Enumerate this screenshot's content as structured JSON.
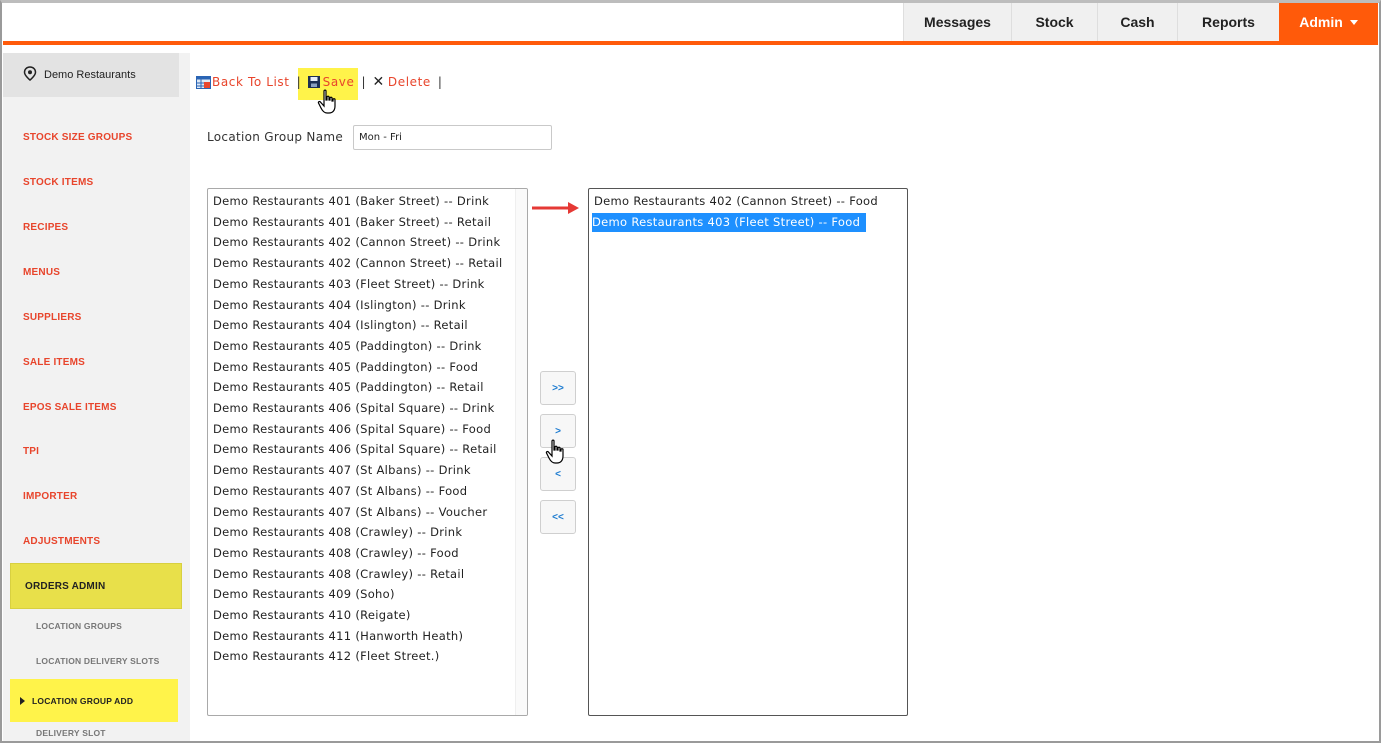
{
  "topnav": {
    "items": [
      "Messages",
      "Stock",
      "Cash",
      "Reports"
    ],
    "admin_label": "Admin"
  },
  "sidebar": {
    "header": "Demo Restaurants",
    "items": [
      "STOCK SIZE GROUPS",
      "STOCK ITEMS",
      "RECIPES",
      "MENUS",
      "SUPPLIERS",
      "SALE ITEMS",
      "EPOS SALE ITEMS",
      "TPI",
      "IMPORTER",
      "ADJUSTMENTS",
      "ORDERS ADMIN"
    ],
    "subitems": [
      "LOCATION GROUPS",
      "LOCATION DELIVERY SLOTS",
      "LOCATION GROUP ADD",
      "DELIVERY SLOT"
    ]
  },
  "toolbar": {
    "back_label": "Back To List",
    "save_label": "Save",
    "delete_label": "Delete",
    "separator": "|"
  },
  "form": {
    "group_name_label": "Location Group Name",
    "group_name_value": "Mon - Fri"
  },
  "available_locations": [
    "Demo Restaurants 401 (Baker Street) -- Drink",
    "Demo Restaurants 401 (Baker Street) -- Retail",
    "Demo Restaurants 402 (Cannon Street) -- Drink",
    "Demo Restaurants 402 (Cannon Street) -- Retail",
    "Demo Restaurants 403 (Fleet Street) -- Drink",
    "Demo Restaurants 404 (Islington) -- Drink",
    "Demo Restaurants 404 (Islington) -- Retail",
    "Demo Restaurants 405 (Paddington) -- Drink",
    "Demo Restaurants 405 (Paddington) -- Food",
    "Demo Restaurants 405 (Paddington) -- Retail",
    "Demo Restaurants 406 (Spital Square) -- Drink",
    "Demo Restaurants 406 (Spital Square) -- Food",
    "Demo Restaurants 406 (Spital Square) -- Retail",
    "Demo Restaurants 407 (St Albans) -- Drink",
    "Demo Restaurants 407 (St Albans) -- Food",
    "Demo Restaurants 407 (St Albans) -- Voucher",
    "Demo Restaurants 408 (Crawley) -- Drink",
    "Demo Restaurants 408 (Crawley) -- Food",
    "Demo Restaurants 408 (Crawley) -- Retail",
    "Demo Restaurants 409 (Soho)",
    "Demo Restaurants 410 (Reigate)",
    "Demo Restaurants 411 (Hanworth Heath)",
    "Demo Restaurants 412 (Fleet Street.)"
  ],
  "selected_locations": [
    "Demo Restaurants 402 (Cannon Street) -- Food",
    "Demo Restaurants 403 (Fleet Street) -- Food"
  ],
  "move_buttons": {
    "move_all_right": ">>",
    "move_right": ">",
    "move_left": "<",
    "move_all_left": "<<"
  },
  "colors": {
    "accent": "#ff5a0a",
    "link": "#e8452c",
    "highlight": "#fff34a",
    "selection": "#1e90ff"
  }
}
